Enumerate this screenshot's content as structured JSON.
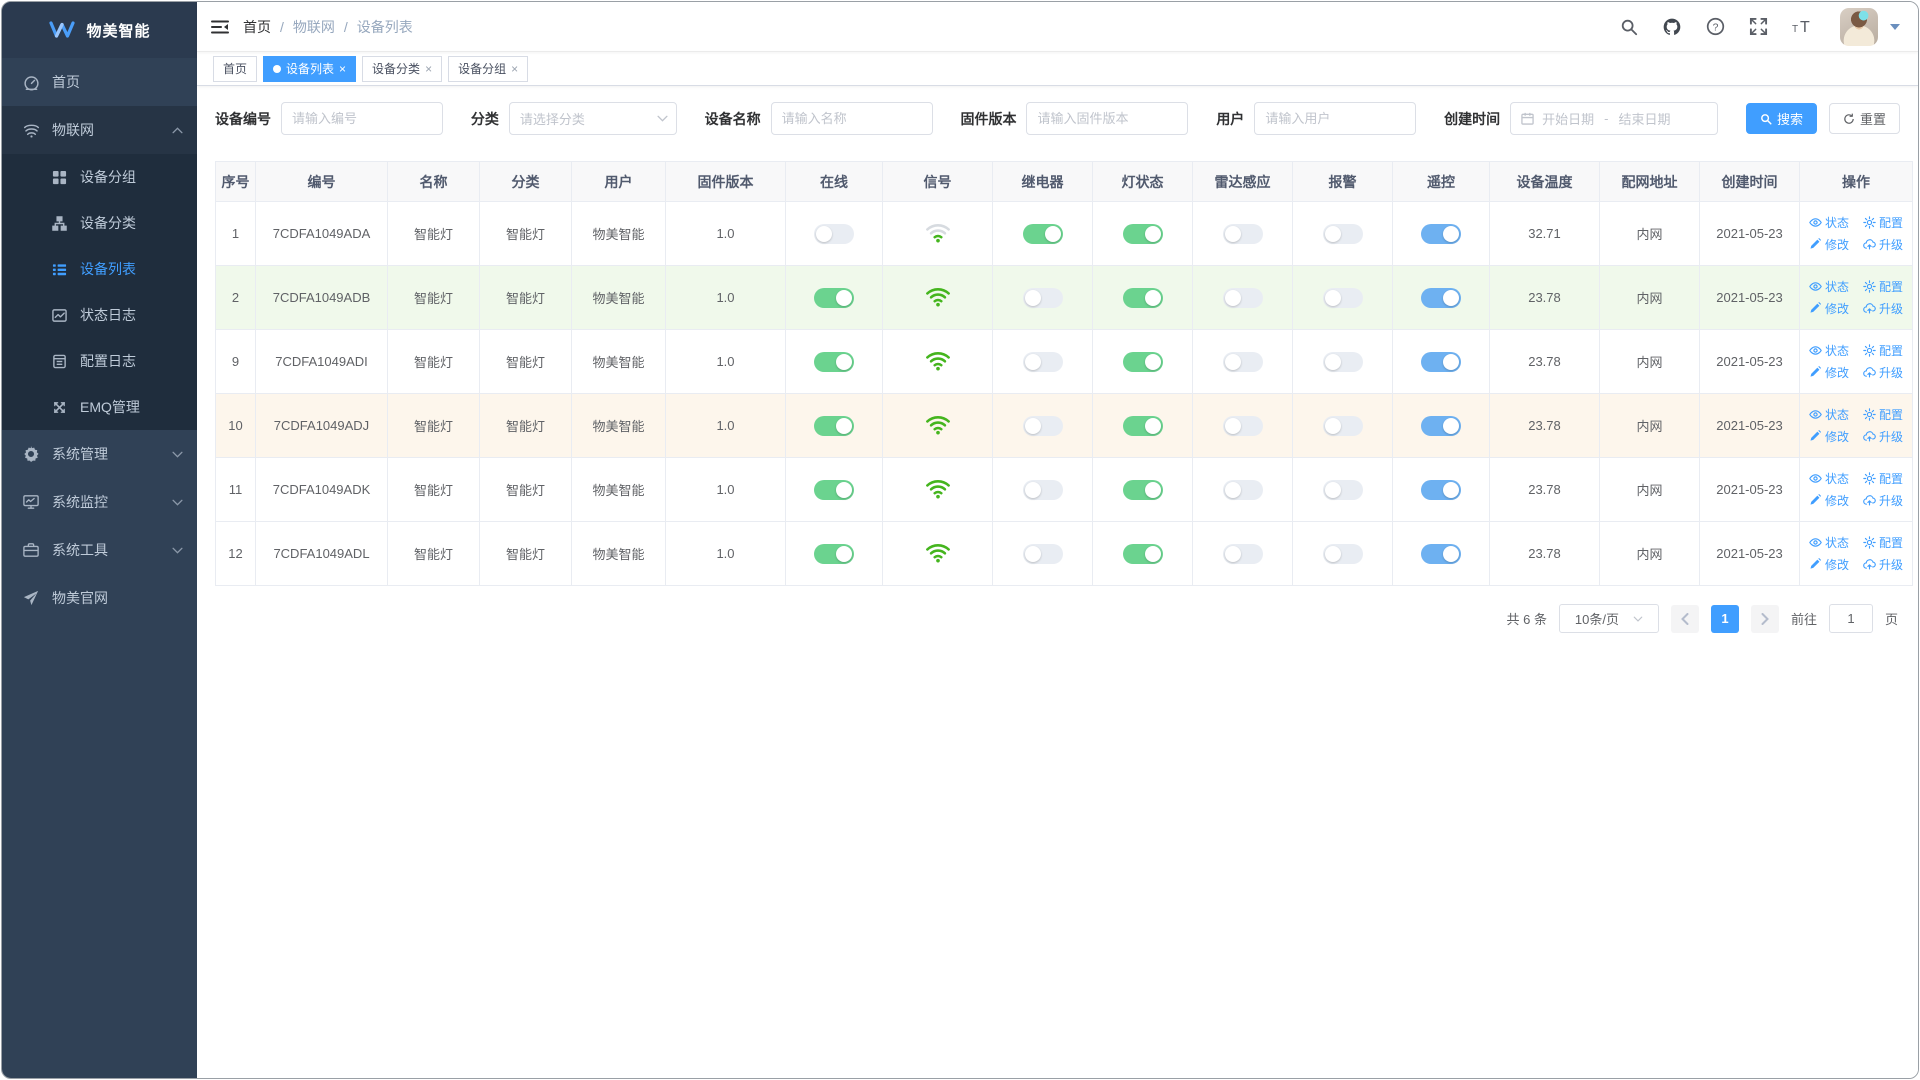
{
  "app": {
    "title": "物美智能"
  },
  "sidebar": {
    "items": [
      {
        "key": "home",
        "label": "首页",
        "icon": "dashboard-icon",
        "children": null,
        "expanded": false,
        "active": false
      },
      {
        "key": "iot",
        "label": "物联网",
        "icon": "iot-icon",
        "expanded": true,
        "active": false,
        "children": [
          {
            "key": "device-group",
            "label": "设备分组",
            "icon": "device-group-icon",
            "active": false
          },
          {
            "key": "device-category",
            "label": "设备分类",
            "icon": "device-category-icon",
            "active": false
          },
          {
            "key": "device-list",
            "label": "设备列表",
            "icon": "device-list-icon",
            "active": true
          },
          {
            "key": "status-log",
            "label": "状态日志",
            "icon": "status-log-icon",
            "active": false
          },
          {
            "key": "config-log",
            "label": "配置日志",
            "icon": "config-log-icon",
            "active": false
          },
          {
            "key": "emq",
            "label": "EMQ管理",
            "icon": "emq-icon",
            "active": false
          }
        ]
      },
      {
        "key": "system-manage",
        "label": "系统管理",
        "icon": "gear-icon",
        "children": [],
        "expanded": false,
        "active": false
      },
      {
        "key": "system-monitor",
        "label": "系统监控",
        "icon": "monitor-icon",
        "children": [],
        "expanded": false,
        "active": false
      },
      {
        "key": "system-tools",
        "label": "系统工具",
        "icon": "briefcase-icon",
        "children": [],
        "expanded": false,
        "active": false
      },
      {
        "key": "official-site",
        "label": "物美官网",
        "icon": "paper-plane-icon",
        "children": null,
        "expanded": false,
        "active": false
      }
    ]
  },
  "breadcrumb": [
    "首页",
    "物联网",
    "设备列表"
  ],
  "tabs": [
    {
      "key": "home",
      "label": "首页",
      "active": false,
      "closable": false
    },
    {
      "key": "device-list",
      "label": "设备列表",
      "active": true,
      "closable": true
    },
    {
      "key": "device-category",
      "label": "设备分类",
      "active": false,
      "closable": true
    },
    {
      "key": "device-group",
      "label": "设备分组",
      "active": false,
      "closable": true
    }
  ],
  "filters": {
    "device_no_label": "设备编号",
    "device_no_placeholder": "请输入编号",
    "category_label": "分类",
    "category_placeholder": "请选择分类",
    "name_label": "设备名称",
    "name_placeholder": "请输入名称",
    "firmware_label": "固件版本",
    "firmware_placeholder": "请输入固件版本",
    "user_label": "用户",
    "user_placeholder": "请输入用户",
    "created_label": "创建时间",
    "start_placeholder": "开始日期",
    "separator": "-",
    "end_placeholder": "结束日期",
    "search_label": "搜索",
    "reset_label": "重置"
  },
  "table": {
    "headers": [
      "序号",
      "编号",
      "名称",
      "分类",
      "用户",
      "固件版本",
      "在线",
      "信号",
      "继电器",
      "灯状态",
      "雷达感应",
      "报警",
      "遥控",
      "设备温度",
      "配网地址",
      "创建时间",
      "操作"
    ],
    "actions": [
      {
        "key": "status",
        "label": "状态",
        "icon": "eye-icon"
      },
      {
        "key": "config",
        "label": "配置",
        "icon": "gear-icon"
      },
      {
        "key": "edit",
        "label": "修改",
        "icon": "pencil-icon"
      },
      {
        "key": "upgrade",
        "label": "升级",
        "icon": "cloud-icon"
      }
    ],
    "rows": [
      {
        "index": "1",
        "code": "7CDFA1049ADA",
        "name": "智能灯",
        "category": "智能灯",
        "user": "物美智能",
        "firmware": "1.0",
        "online": false,
        "signal": "weak",
        "relay": true,
        "light": true,
        "radar": false,
        "alarm": false,
        "remote": true,
        "temperature": "32.71",
        "network": "内网",
        "created": "2021-05-23",
        "highlight": "none"
      },
      {
        "index": "2",
        "code": "7CDFA1049ADB",
        "name": "智能灯",
        "category": "智能灯",
        "user": "物美智能",
        "firmware": "1.0",
        "online": true,
        "signal": "strong",
        "relay": false,
        "light": true,
        "radar": false,
        "alarm": false,
        "remote": true,
        "temperature": "23.78",
        "network": "内网",
        "created": "2021-05-23",
        "highlight": "green"
      },
      {
        "index": "9",
        "code": "7CDFA1049ADI",
        "name": "智能灯",
        "category": "智能灯",
        "user": "物美智能",
        "firmware": "1.0",
        "online": true,
        "signal": "strong",
        "relay": false,
        "light": true,
        "radar": false,
        "alarm": false,
        "remote": true,
        "temperature": "23.78",
        "network": "内网",
        "created": "2021-05-23",
        "highlight": "none"
      },
      {
        "index": "10",
        "code": "7CDFA1049ADJ",
        "name": "智能灯",
        "category": "智能灯",
        "user": "物美智能",
        "firmware": "1.0",
        "online": true,
        "signal": "strong",
        "relay": false,
        "light": true,
        "radar": false,
        "alarm": false,
        "remote": true,
        "temperature": "23.78",
        "network": "内网",
        "created": "2021-05-23",
        "highlight": "orange"
      },
      {
        "index": "11",
        "code": "7CDFA1049ADK",
        "name": "智能灯",
        "category": "智能灯",
        "user": "物美智能",
        "firmware": "1.0",
        "online": true,
        "signal": "strong",
        "relay": false,
        "light": true,
        "radar": false,
        "alarm": false,
        "remote": true,
        "temperature": "23.78",
        "network": "内网",
        "created": "2021-05-23",
        "highlight": "none"
      },
      {
        "index": "12",
        "code": "7CDFA1049ADL",
        "name": "智能灯",
        "category": "智能灯",
        "user": "物美智能",
        "firmware": "1.0",
        "online": true,
        "signal": "strong",
        "relay": false,
        "light": true,
        "radar": false,
        "alarm": false,
        "remote": true,
        "temperature": "23.78",
        "network": "内网",
        "created": "2021-05-23",
        "highlight": "none"
      }
    ]
  },
  "pagination": {
    "total": "共 6 条",
    "page_size": "10条/页",
    "current_page": "1",
    "goto_label": "前往",
    "goto_value": "1",
    "unit_label": "页"
  },
  "colors": {
    "accent": "#409EFF",
    "toggle_on_green": "#6bd38f",
    "toggle_on_blue": "#6eb1f1",
    "toggle_off": "#e9edf3",
    "wifi_green": "#45b51e",
    "row_green": "#f0f9eb",
    "row_orange": "#fdf6ec",
    "sidebar_bg": "#304156",
    "submenu_bg": "#1f2d3d"
  }
}
